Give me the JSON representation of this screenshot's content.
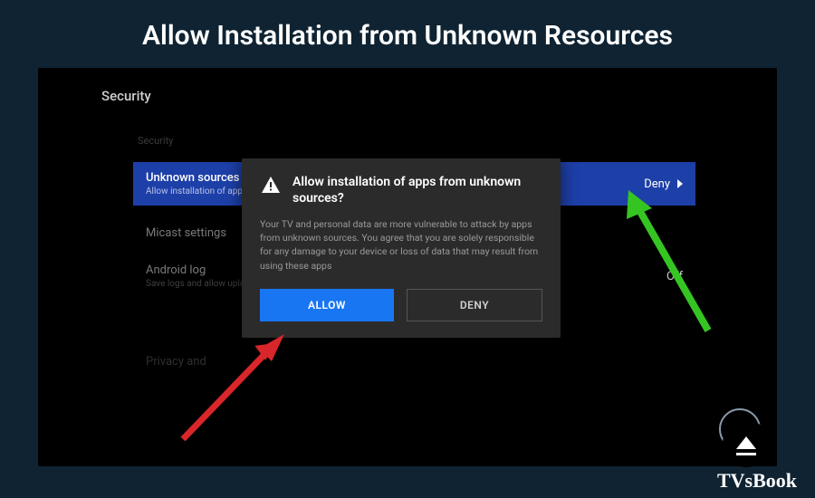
{
  "page_title": "Allow Installation from Unknown Resources",
  "watermark": "TVsBook",
  "security": {
    "header": "Security",
    "section_label": "Security",
    "rows": {
      "unknown": {
        "title": "Unknown sources",
        "sub": "Allow installation of apps from",
        "value": "Deny"
      },
      "micast": {
        "title": "Micast settings"
      },
      "android": {
        "title": "Android log",
        "sub": "Save logs and allow upload l",
        "value": "Off"
      },
      "privacy": {
        "title": "Privacy and"
      }
    }
  },
  "dialog": {
    "title": "Allow installation of apps from unknown sources?",
    "body": "Your TV and personal data are more vulnerable to attack by apps from unknown sources. You agree that you are solely responsible for any damage to your device or loss of data that may result from using these apps",
    "allow": "ALLOW",
    "deny": "DENY"
  },
  "colors": {
    "accent": "#1976f2",
    "row_highlight": "#1d3fa8",
    "arrow_red": "#d9262a",
    "arrow_green": "#35c522"
  }
}
